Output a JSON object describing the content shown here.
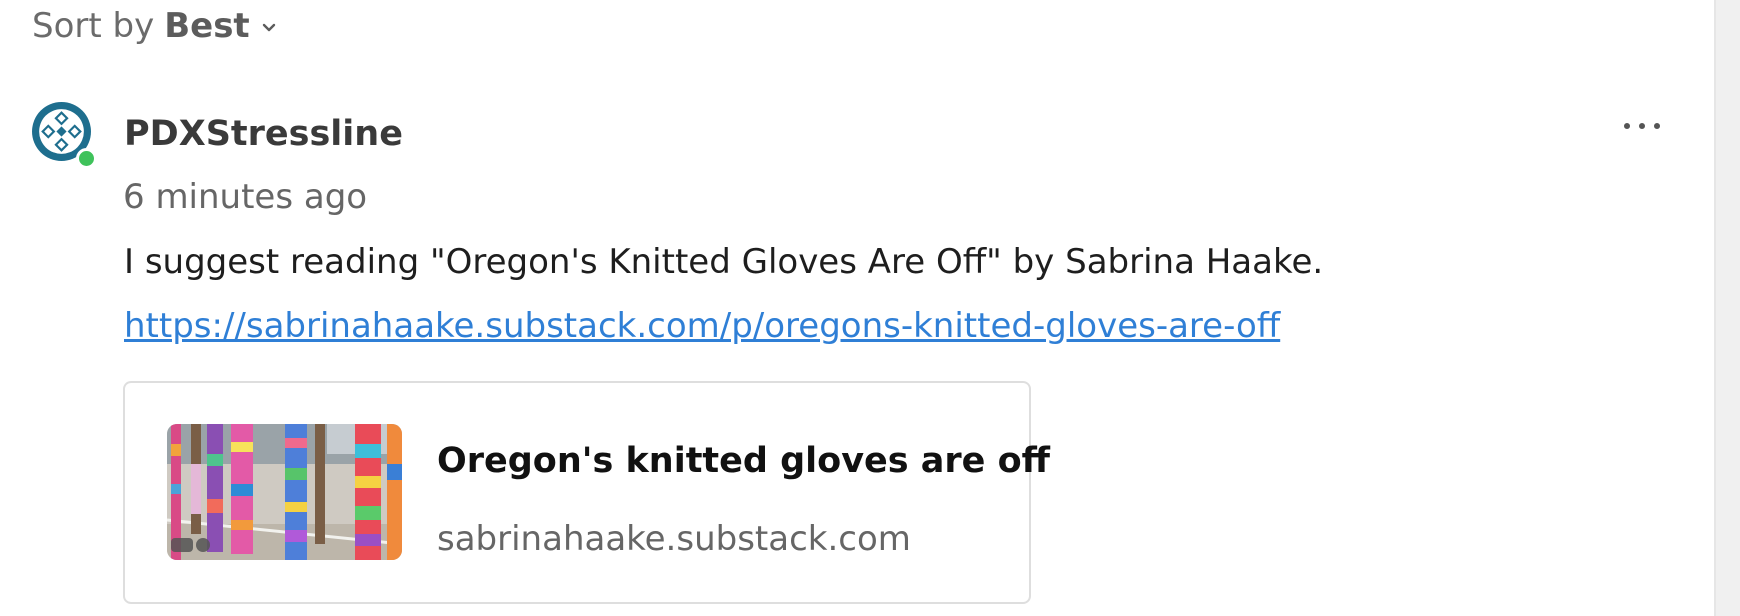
{
  "sort": {
    "prefix": "Sort by",
    "value": "Best"
  },
  "comment": {
    "username": "PDXStressline",
    "timestamp": "6 minutes ago",
    "body": "I suggest reading \"Oregon's Knitted Gloves Are Off\" by Sabrina Haake.",
    "link": "https://sabrinahaake.substack.com/p/oregons-knitted-gloves-are-off",
    "online": true
  },
  "link_card": {
    "title": "Oregon's knitted gloves are off",
    "domain": "sabrinahaake.substack.com"
  },
  "icons": {
    "sort_chevron": "chevron-down-icon",
    "more": "more-options-icon",
    "avatar": "geometric-avatar-icon"
  },
  "colors": {
    "link": "#2f7fd6",
    "online": "#3fc25b",
    "avatar": "#1e6e8e"
  }
}
